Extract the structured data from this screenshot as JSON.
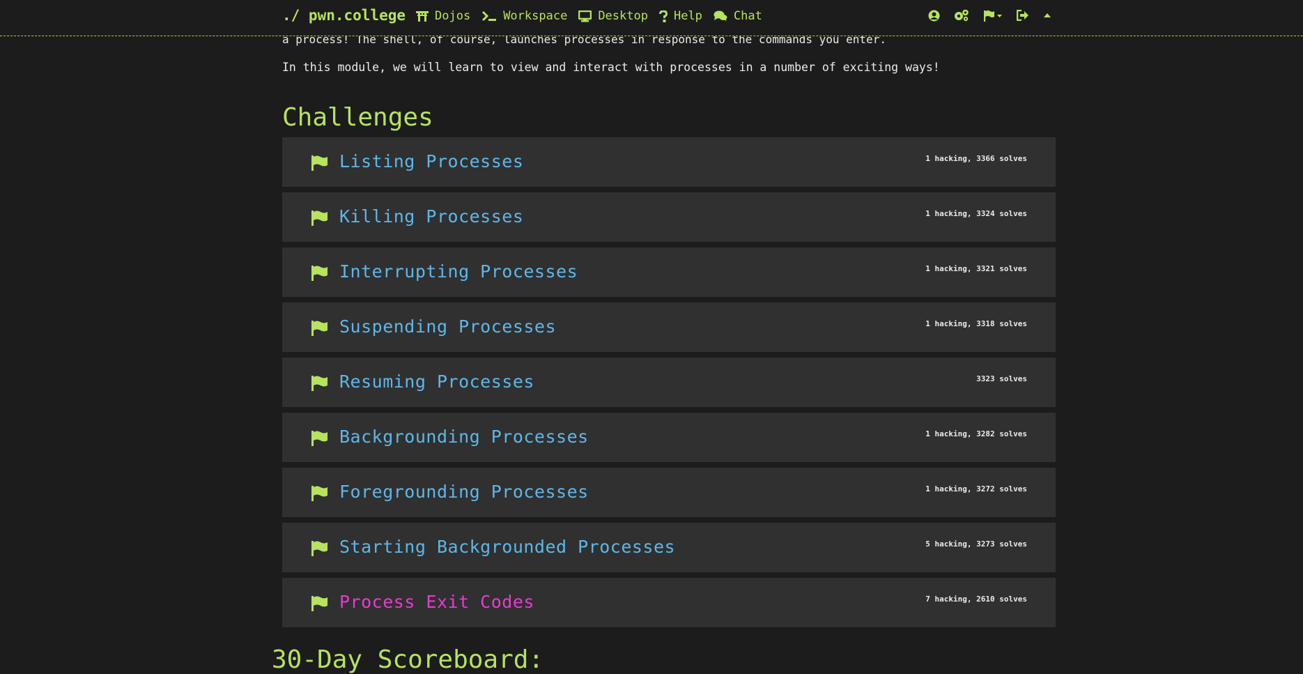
{
  "nav": {
    "brand": "./ pwn.college",
    "items": [
      {
        "label": "Dojos",
        "icon": "torii-gate-icon"
      },
      {
        "label": "Workspace",
        "icon": "terminal-icon"
      },
      {
        "label": "Desktop",
        "icon": "desktop-icon"
      },
      {
        "label": "Help",
        "icon": "question-icon"
      },
      {
        "label": "Chat",
        "icon": "comments-icon"
      }
    ],
    "right_icons": [
      "user-circle-icon",
      "gears-icon",
      "flag-dropdown-icon",
      "sign-out-icon",
      "caret-up-icon"
    ]
  },
  "intro": {
    "cut_line": "a process! The shell, of course, launches processes in response to the commands you enter.",
    "text": "In this module, we will learn to view and interact with processes in a number of exciting ways!"
  },
  "challenges_title": "Challenges",
  "challenges": [
    {
      "name": "Listing Processes",
      "stats": "1 hacking, 3366 solves"
    },
    {
      "name": "Killing Processes",
      "stats": "1 hacking, 3324 solves"
    },
    {
      "name": "Interrupting Processes",
      "stats": "1 hacking, 3321 solves"
    },
    {
      "name": "Suspending Processes",
      "stats": "1 hacking, 3318 solves"
    },
    {
      "name": "Resuming Processes",
      "stats": "3323 solves"
    },
    {
      "name": "Backgrounding Processes",
      "stats": "1 hacking, 3282 solves"
    },
    {
      "name": "Foregrounding Processes",
      "stats": "1 hacking, 3272 solves"
    },
    {
      "name": "Starting Backgrounded Processes",
      "stats": "5 hacking, 3273 solves"
    },
    {
      "name": "Process Exit Codes",
      "stats": "7 hacking, 2610 solves"
    }
  ],
  "scoreboard_title": "30-Day Scoreboard:",
  "colors": {
    "accent": "#b7e35d",
    "challenge_link": "#5fb7e8",
    "challenge_link_active": "#e83ccf",
    "card_bg": "#303031",
    "page_bg": "#1c1c1d"
  }
}
